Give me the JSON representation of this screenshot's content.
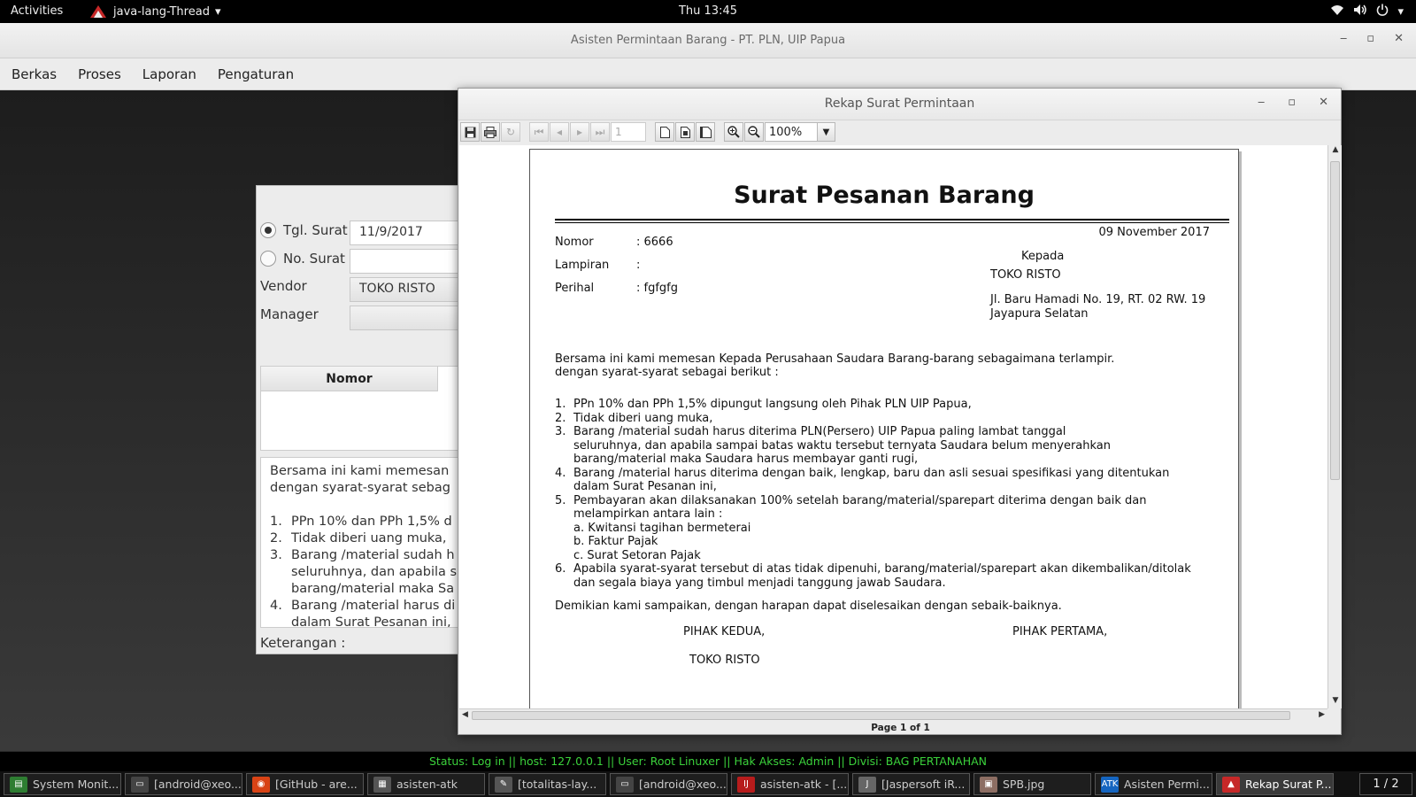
{
  "topbar": {
    "activities": "Activities",
    "app_name": "java-lang-Thread",
    "clock": "Thu 13:45"
  },
  "main_window": {
    "title": "Asisten Permintaan Barang - PT. PLN, UIP Papua",
    "menu": [
      "Berkas",
      "Proses",
      "Laporan",
      "Pengaturan"
    ]
  },
  "form": {
    "tgl_label": "Tgl. Surat",
    "tgl_value": "11/9/2017",
    "no_label": "No. Surat",
    "no_value": "",
    "vendor_label": "Vendor",
    "vendor_value": "TOKO RISTO",
    "manager_label": "Manager",
    "manager_value": "",
    "table_header_nomor": "Nomor",
    "text_line1": "Bersama ini kami memesan",
    "text_line2": "dengan syarat-syarat sebag",
    "items": [
      {
        "n": "1.",
        "t": "PPn 10% dan PPh 1,5% d"
      },
      {
        "n": "2.",
        "t": "Tidak diberi uang muka,"
      },
      {
        "n": "3.",
        "t": "Barang /material sudah h"
      },
      {
        "n": "",
        "t": "seluruhnya, dan apabila s"
      },
      {
        "n": "",
        "t": "barang/material maka Sa"
      },
      {
        "n": "4.",
        "t": "Barang /material harus di"
      },
      {
        "n": "",
        "t": "dalam Surat Pesanan ini,"
      }
    ],
    "keterangan_label": "Keterangan :"
  },
  "viewer": {
    "title": "Rekap Surat Permintaan",
    "page_input": "1",
    "zoom": "100%",
    "page_indicator": "Page 1 of 1"
  },
  "report": {
    "title": "Surat Pesanan Barang",
    "date": "09 November 2017",
    "nomor_label": "Nomor",
    "nomor_value": ": 6666",
    "lampiran_label": "Lampiran",
    "lampiran_value": ":",
    "perihal_label": "Perihal",
    "perihal_value": ": fgfgfg",
    "kepada": "Kepada",
    "recipient": "TOKO RISTO",
    "address1": "Jl. Baru Hamadi No. 19, RT. 02 RW. 19",
    "address2": "Jayapura Selatan",
    "intro1": "Bersama ini kami memesan Kepada Perusahaan Saudara Barang-barang sebagaimana terlampir.",
    "intro2": "dengan syarat-syarat sebagai berikut :",
    "terms": [
      {
        "n": "1.",
        "lines": [
          "PPn 10% dan PPh 1,5% dipungut langsung oleh Pihak PLN UIP Papua,"
        ]
      },
      {
        "n": "2.",
        "lines": [
          "Tidak diberi uang muka,"
        ]
      },
      {
        "n": "3.",
        "lines": [
          "Barang /material sudah harus diterima PLN(Persero) UIP Papua paling lambat tanggal",
          "seluruhnya, dan apabila sampai batas waktu tersebut ternyata Saudara belum menyerahkan",
          "barang/material maka Saudara harus membayar ganti rugi,"
        ]
      },
      {
        "n": "4.",
        "lines": [
          "Barang /material harus diterima dengan baik, lengkap, baru dan asli sesuai spesifikasi yang ditentukan",
          "dalam Surat Pesanan ini,"
        ]
      },
      {
        "n": "5.",
        "lines": [
          "Pembayaran akan dilaksanakan 100% setelah barang/material/sparepart diterima dengan baik dan",
          "melampirkan antara lain :",
          "a. Kwitansi tagihan bermeterai",
          "b. Faktur Pajak",
          "c. Surat Setoran Pajak"
        ]
      },
      {
        "n": "6.",
        "lines": [
          "Apabila syarat-syarat tersebut di atas tidak dipenuhi, barang/material/sparepart akan dikembalikan/ditolak",
          "dan segala biaya yang timbul menjadi tanggung jawab Saudara."
        ]
      }
    ],
    "closing": "Demikian kami sampaikan, dengan harapan dapat diselesaikan dengan sebaik-baiknya.",
    "party2": "PIHAK KEDUA,",
    "party1": "PIHAK PERTAMA,",
    "party2_name": "TOKO RISTO"
  },
  "status_bar": "Status: Log in  ||  host: 127.0.0.1  ||  User: Root Linuxer  ||  Hak Akses: Admin  ||  Divisi: BAG PERTANAHAN",
  "taskbar": {
    "tasks": [
      {
        "label": "System Monit...",
        "icon": "monitor-icon",
        "color": "#2e7d32"
      },
      {
        "label": "[android@xeo...",
        "icon": "terminal-icon",
        "color": "#444"
      },
      {
        "label": "[GitHub - are...",
        "icon": "chrome-icon",
        "color": "#d84315"
      },
      {
        "label": "asisten-atk",
        "icon": "file-icon",
        "color": "#555"
      },
      {
        "label": "[totalitas-lay...",
        "icon": "editor-icon",
        "color": "#555"
      },
      {
        "label": "[android@xeo...",
        "icon": "terminal-icon",
        "color": "#444"
      },
      {
        "label": "asisten-atk - [...",
        "icon": "intellij-icon",
        "color": "#b71c1c"
      },
      {
        "label": "[Jaspersoft iR...",
        "icon": "jaspersoft-icon",
        "color": "#666"
      },
      {
        "label": "SPB.jpg",
        "icon": "image-icon",
        "color": "#8d6e63"
      },
      {
        "label": "Asisten Permi...",
        "icon": "atk-icon",
        "color": "#1565c0"
      },
      {
        "label": "Rekap Surat P...",
        "icon": "java-icon",
        "color": "#c62828"
      }
    ],
    "pager": "1 / 2"
  }
}
